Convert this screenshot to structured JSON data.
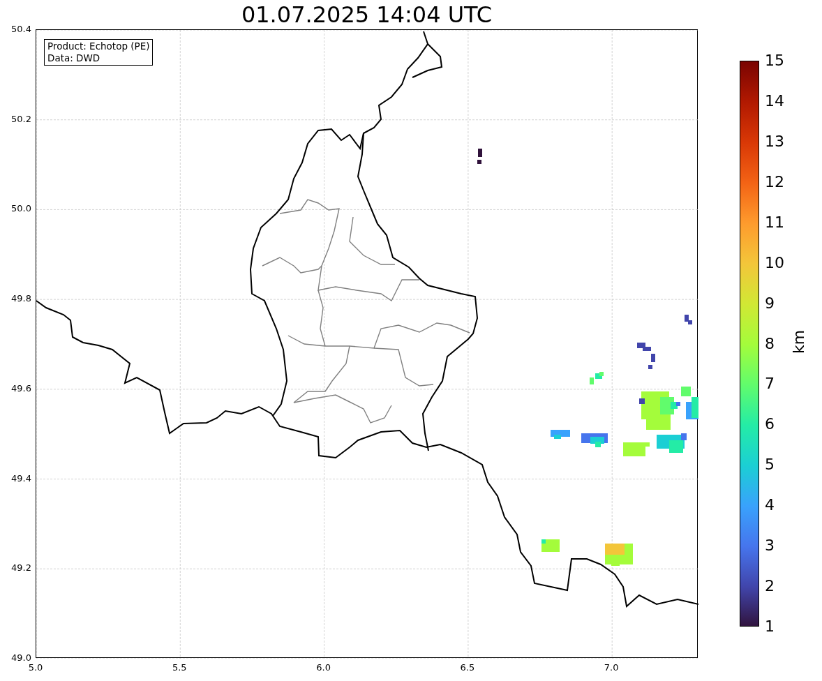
{
  "title": "01.07.2025 14:04 UTC",
  "legend": {
    "lines": [
      "Product: Echotop (PE)",
      "Data: DWD"
    ]
  },
  "map": {
    "x_ticks": [
      "5.0",
      "5.5",
      "6.0",
      "6.5",
      "7.0"
    ],
    "y_ticks": [
      "50.4",
      "50.2",
      "50.0",
      "49.8",
      "49.6",
      "49.4",
      "49.2",
      "49.0"
    ]
  },
  "colorbar": {
    "label": "km",
    "ticks": [
      "15",
      "14",
      "13",
      "12",
      "11",
      "10",
      "9",
      "8",
      "7",
      "6",
      "5",
      "4",
      "3",
      "2",
      "1"
    ]
  }
}
